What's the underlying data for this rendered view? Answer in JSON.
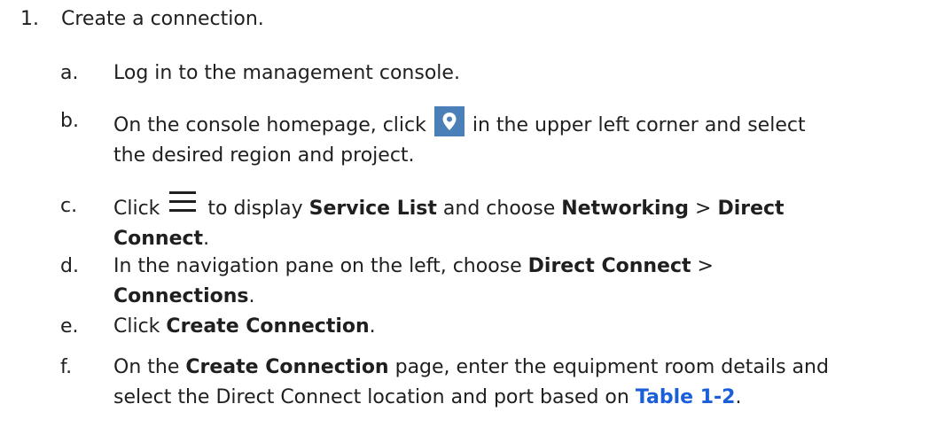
{
  "step": {
    "number": "1.",
    "title": "Create a connection."
  },
  "substeps": [
    {
      "letter": "a.",
      "text": "Log in to the management console."
    },
    {
      "letter": "b.",
      "before": "On the console homepage, click",
      "after": "in the upper left corner and select",
      "line2": "the desired region and project.",
      "icon": "location-pin-icon"
    },
    {
      "letter": "c.",
      "before": "Click",
      "icon": "menu-icon",
      "mid1": "to display",
      "bold1": "Service List",
      "mid2": "and choose",
      "bold2": "Networking",
      "sep": ">",
      "bold3": "Direct",
      "line2_bold": "Connect",
      "line2_end": "."
    },
    {
      "letter": "d.",
      "before": "In the navigation pane on the left, choose",
      "bold1": "Direct Connect",
      "sep": ">",
      "line2_bold": "Connections",
      "line2_end": "."
    },
    {
      "letter": "e.",
      "before": "Click",
      "bold1": "Create Connection",
      "end": "."
    },
    {
      "letter": "f.",
      "before": "On the",
      "bold1": "Create Connection",
      "mid1": "page, enter the equipment room details and",
      "line2": "select the Direct Connect location and port based on",
      "link": "Table 1-2",
      "end": "."
    }
  ],
  "colors": {
    "link": "#1a5fd8",
    "pin_bg": "#4a7fb8",
    "text": "#1f1f1f"
  }
}
